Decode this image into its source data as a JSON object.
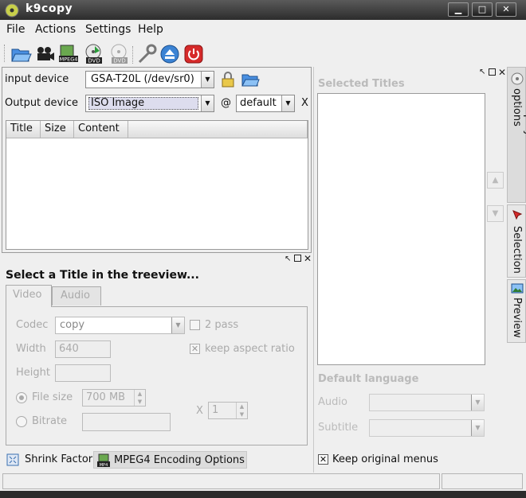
{
  "window": {
    "title": "k9copy",
    "minimize_icon": "minimize-icon",
    "maximize_icon": "maximize-icon",
    "close_icon": "close-icon"
  },
  "menubar": {
    "file": "File",
    "actions": "Actions",
    "settings": "Settings",
    "help": "Help"
  },
  "toolbar": {
    "icons": [
      "open-folder-icon",
      "film-camera-icon",
      "mpeg4-icon",
      "dvd-copy-icon",
      "dvd-disabled-icon",
      "wrench-icon",
      "eject-icon",
      "power-icon"
    ],
    "mpeg4_text": "MPEG4",
    "dvd_text": "DVD"
  },
  "devices": {
    "input_label": "input device",
    "input_value": "GSA-T20L  (/dev/sr0)",
    "output_label": "Output device",
    "output_value": "ISO Image",
    "at_sign": "@",
    "target_value": "default",
    "x_label": "X"
  },
  "titles_table": {
    "columns": [
      "Title",
      "Size",
      "Content"
    ]
  },
  "encoding_panel": {
    "heading": "Select a Title in the treeview...",
    "tabs": {
      "video": "Video",
      "audio": "Audio"
    },
    "codec_label": "Codec",
    "codec_value": "copy",
    "two_pass_label": "2 pass",
    "width_label": "Width",
    "width_value": "640",
    "keep_aspect_label": "keep aspect ratio",
    "height_label": "Height",
    "height_value": "",
    "file_size_label": "File size",
    "file_size_value": "700 MB",
    "bitrate_label": "Bitrate",
    "bitrate_value": "",
    "x_label": "X",
    "passes_value": "1"
  },
  "bottom_tabs": {
    "shrink_factor": "Shrink Factor",
    "mpeg4_options": "MPEG4 Encoding Options",
    "mpeg4_icon_text": "MP4"
  },
  "right_panel": {
    "selected_titles_label": "Selected Titles",
    "default_language_label": "Default language",
    "audio_label": "Audio",
    "audio_value": "",
    "subtitle_label": "Subtitle",
    "subtitle_value": "",
    "keep_menus_label": "Keep original menus",
    "keep_menus_checked": true
  },
  "side_tabs": {
    "dvd_playback": "DVD playback options",
    "selection": "Selection",
    "preview": "Preview"
  },
  "statusbar": {
    "left_text": "",
    "right_text": ""
  }
}
